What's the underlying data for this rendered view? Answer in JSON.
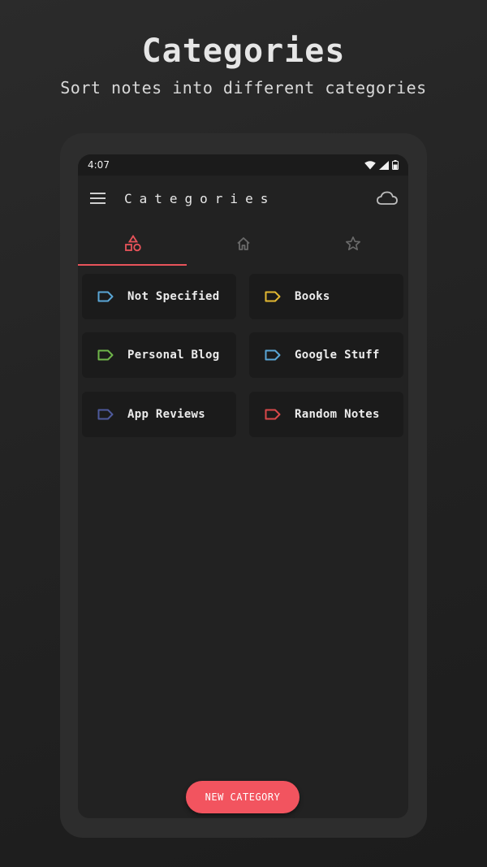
{
  "promo": {
    "headline": "Categories",
    "subheadline": "Sort notes into different categories"
  },
  "status_bar": {
    "time": "4:07",
    "icons": [
      "wifi-icon",
      "signal-icon",
      "battery-icon"
    ]
  },
  "app_bar": {
    "menu_icon": "hamburger-menu-icon",
    "title": "Categories",
    "action_icon": "cloud-icon"
  },
  "tabs": [
    {
      "icon": "shapes-icon",
      "selected": true
    },
    {
      "icon": "home-icon",
      "selected": false
    },
    {
      "icon": "star-icon",
      "selected": false
    }
  ],
  "categories": [
    {
      "label": "Not Specified",
      "color": "#5aa6d6"
    },
    {
      "label": "Books",
      "color": "#e3b832"
    },
    {
      "label": "Personal Blog",
      "color": "#6fb54a"
    },
    {
      "label": "Google Stuff",
      "color": "#5aa6d6"
    },
    {
      "label": "App Reviews",
      "color": "#4e5a9c"
    },
    {
      "label": "Random Notes",
      "color": "#d9484a"
    }
  ],
  "fab": {
    "label": "NEW CATEGORY"
  },
  "colors": {
    "accent": "#e8535a",
    "fab": "#f2545f",
    "card": "#1b1b1b",
    "background": "#222222"
  }
}
